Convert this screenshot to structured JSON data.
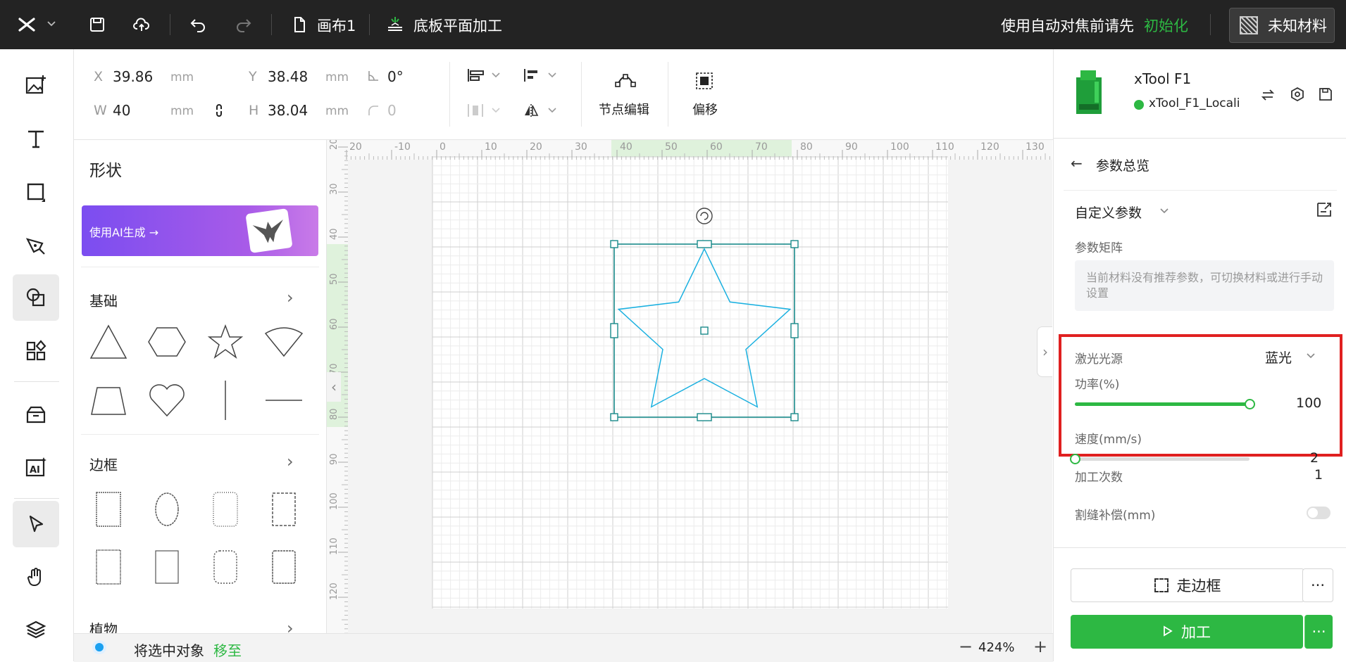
{
  "topbar": {
    "canvas_name": "画布1",
    "process_mode": "底板平面加工",
    "autofocus_hint": "使用自动对焦前请先",
    "init_link": "初始化",
    "material": "未知材料"
  },
  "props": {
    "x_label": "X",
    "x_value": "39.86",
    "x_unit": "mm",
    "y_label": "Y",
    "y_value": "38.48",
    "y_unit": "mm",
    "w_label": "W",
    "w_value": "40",
    "w_unit": "mm",
    "h_label": "H",
    "h_value": "38.04",
    "h_unit": "mm",
    "angle": "0°",
    "corner": "0",
    "node_edit": "节点编辑",
    "offset": "偏移"
  },
  "shapes_panel": {
    "title": "形状",
    "ai_banner": "使用AI生成 →",
    "basic": "基础",
    "frames": "边框",
    "plants": "植物"
  },
  "ruler": {
    "top_ticks": [
      "20",
      "-10",
      "0",
      "10",
      "20",
      "30",
      "40",
      "50",
      "60",
      "70",
      "80",
      "90",
      "100",
      "110",
      "120",
      "130"
    ],
    "left_ticks": [
      "20",
      "30",
      "40",
      "50",
      "60",
      "70",
      "80",
      "90",
      "100",
      "110",
      "120"
    ]
  },
  "status": {
    "move_hint": "将选中对象",
    "move_link": "移至",
    "zoom": "424%"
  },
  "device": {
    "model": "xTool F1",
    "connection": "xTool_F1_Locali",
    "status_color": "#2db843"
  },
  "params": {
    "back_title": "参数总览",
    "preset": "自定义参数",
    "matrix_label": "参数矩阵",
    "matrix_hint": "当前材料没有推荐参数，可切换材料或进行手动设置",
    "laser_label": "激光光源",
    "laser_value": "蓝光",
    "power_label": "功率(%)",
    "power_value": "100",
    "power_fraction": 1.0,
    "speed_label": "速度(mm/s)",
    "speed_value": "2",
    "speed_fraction": 0.0,
    "passes_label": "加工次数",
    "passes_value": "1",
    "kerf_label": "割缝补偿(mm)",
    "kerf_enabled": false
  },
  "actions": {
    "frame": "走边框",
    "process": "加工",
    "more": "···"
  },
  "colors": {
    "accent_green": "#2db843",
    "highlight_red": "#e02020",
    "selection_teal": "#1a8a8a",
    "star_blue": "#1ab0e0"
  }
}
